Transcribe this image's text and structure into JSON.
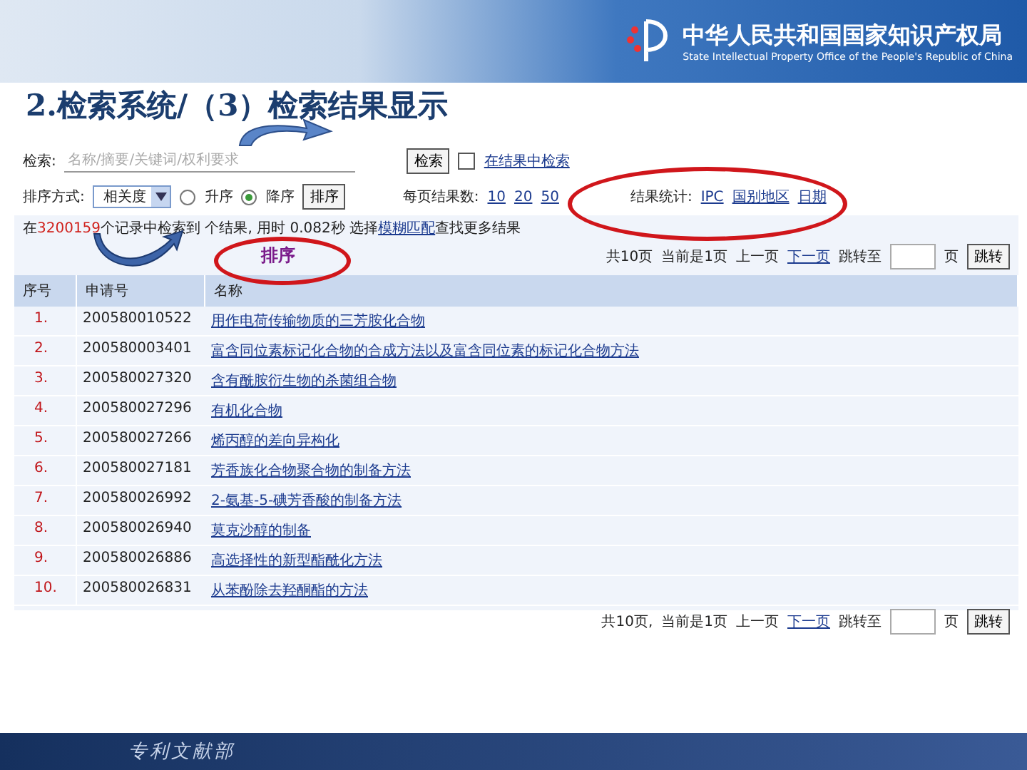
{
  "banner": {
    "org_name": "中华人民共和国国家知识产权局",
    "org_name_en": "State Intellectual Property Office of the People's Republic of China"
  },
  "slide_title": "2.检索系统/（3）检索结果显示",
  "search": {
    "label": "检索:",
    "placeholder": "名称/摘要/关键词/权利要求",
    "button": "检索",
    "in_results": {
      "label": "在结果中检索",
      "checked": false
    }
  },
  "sort": {
    "label": "排序方式:",
    "value": "相关度",
    "options": [
      {
        "label": "升序",
        "selected": false
      },
      {
        "label": "降序",
        "selected": true
      }
    ],
    "button": "排序"
  },
  "per_page": {
    "label": "每页结果数:",
    "options": [
      "10",
      "20",
      "50"
    ]
  },
  "stats": {
    "label": "结果统计:",
    "links": [
      "IPC",
      "国别地区",
      "日期"
    ]
  },
  "summary": {
    "prefix": "在",
    "count": "3200159",
    "middle": "个记录中检索到 个结果, 用时 0.082秒 选择",
    "link": "模糊匹配",
    "suffix": "查找更多结果"
  },
  "pager_top": {
    "total": "共10页",
    "current": "当前是1页",
    "prev": "上一页",
    "next": "下一页",
    "goto": "跳转至",
    "unit": "页",
    "button": "跳转"
  },
  "table": {
    "columns": [
      "序号",
      "申请号",
      "名称"
    ],
    "rows": [
      {
        "no": "1.",
        "app": "200580010522",
        "name": "用作电荷传输物质的三芳胺化合物"
      },
      {
        "no": "2.",
        "app": "200580003401",
        "name": "富含同位素标记化合物的合成方法以及富含同位素的标记化合物方法"
      },
      {
        "no": "3.",
        "app": "200580027320",
        "name": "含有酰胺衍生物的杀菌组合物"
      },
      {
        "no": "4.",
        "app": "200580027296",
        "name": "有机化合物"
      },
      {
        "no": "5.",
        "app": "200580027266",
        "name": "烯丙醇的差向异构化"
      },
      {
        "no": "6.",
        "app": "200580027181",
        "name": "芳香族化合物聚合物的制备方法"
      },
      {
        "no": "7.",
        "app": "200580026992",
        "name": "2-氨基-5-碘芳香酸的制备方法"
      },
      {
        "no": "8.",
        "app": "200580026940",
        "name": "莫克沙醇的制备"
      },
      {
        "no": "9.",
        "app": "200580026886",
        "name": "高选择性的新型酯酰化方法"
      },
      {
        "no": "10.",
        "app": "200580026831",
        "name": "从苯酚除去羟酮酯的方法"
      }
    ]
  },
  "pager_bottom": {
    "total": "共10页,",
    "current": "当前是1页",
    "prev": "上一页",
    "next": "下一页",
    "goto": "跳转至",
    "unit": "页",
    "button": "跳转"
  },
  "annotation": {
    "label": "排序"
  },
  "footer": {
    "department": "专利文献部"
  }
}
